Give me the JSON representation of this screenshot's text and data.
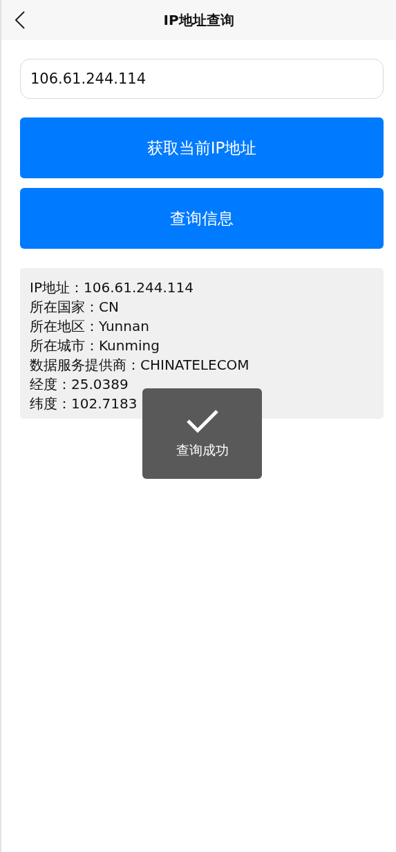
{
  "header": {
    "title": "IP地址查询"
  },
  "ip_input": {
    "value": "106.61.244.114"
  },
  "buttons": [
    "获取当前IP地址",
    "查询信息"
  ],
  "result_lines": [
    "IP地址：106.61.244.114",
    "所在国家：CN",
    "所在地区：Yunnan",
    "所在城市：Kunming",
    "数据服务提供商：CHINATELECOM",
    "经度：25.0389",
    "纬度：102.7183"
  ],
  "toast": {
    "message": "查询成功"
  }
}
